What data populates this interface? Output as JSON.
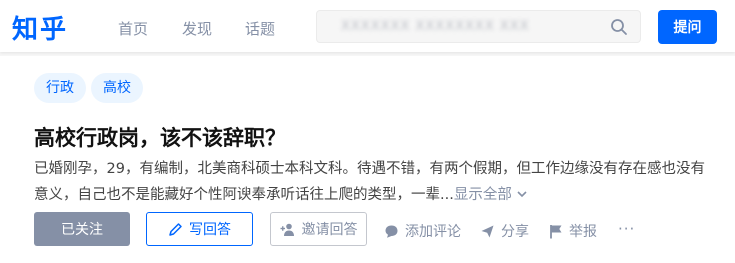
{
  "header": {
    "logo": "知乎",
    "nav": [
      "首页",
      "发现",
      "话题"
    ],
    "search": {
      "value": "XXXXXXX XXXXXXXX XXX",
      "icon": "search-icon"
    },
    "ask_button": "提问",
    "brand_color": "#0066ff"
  },
  "question": {
    "tags": [
      "行政",
      "高校"
    ],
    "title": "高校行政岗，该不该辞职？",
    "excerpt": "已婚刚孕，29，有编制，北美商科硕士本科文科。待遇不错，有两个假期，但工作边缘没有存在感也没有意义，自己也不是能藏好个性阿谀奉承听话往上爬的类型，一辈...",
    "show_all": "显示全部"
  },
  "actions": {
    "followed": "已关注",
    "write_answer": "写回答",
    "invite_answer": "邀请回答",
    "comment": "添加评论",
    "share": "分享",
    "report": "举报",
    "more": "···"
  }
}
